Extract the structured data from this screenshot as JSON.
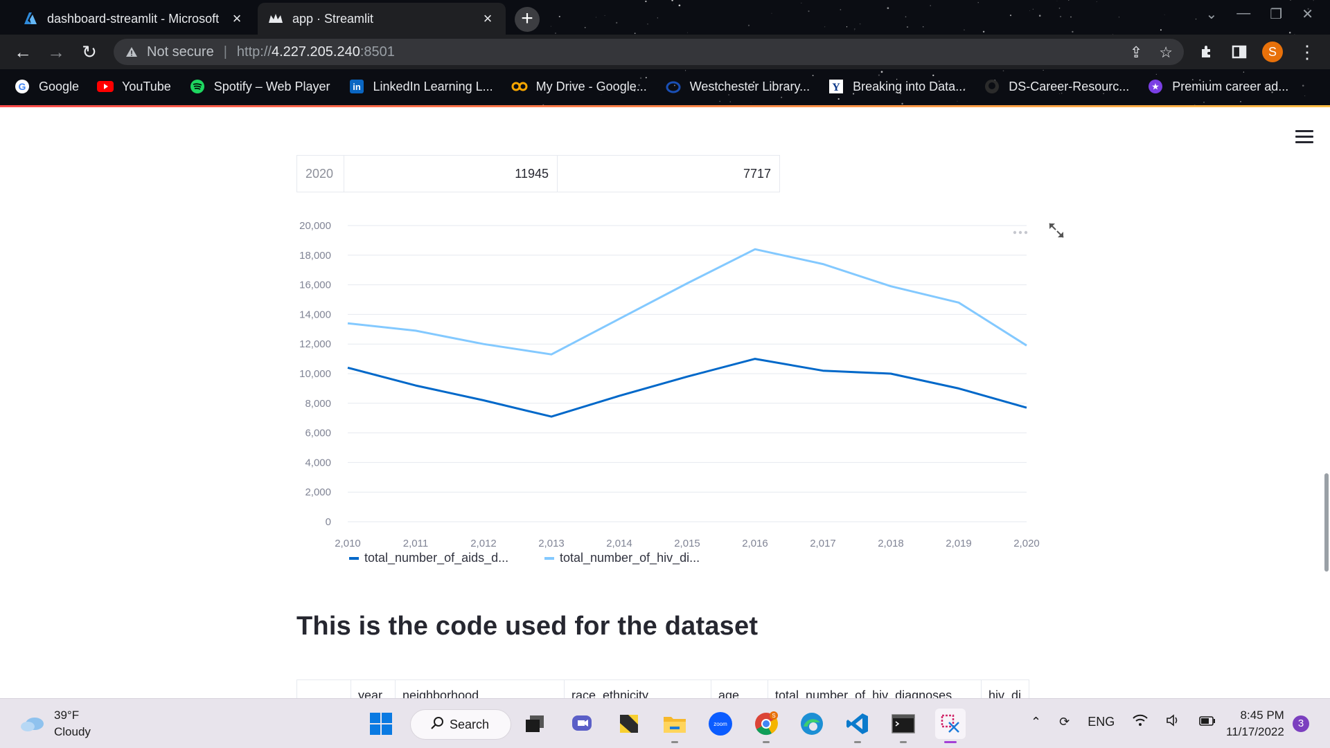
{
  "browser": {
    "tabs": [
      {
        "title": "dashboard-streamlit - Microsoft",
        "active": false
      },
      {
        "title": "app · Streamlit",
        "active": true
      }
    ],
    "security_label": "Not secure",
    "url_scheme": "http://",
    "url_host": "4.227.205.240",
    "url_port": ":8501",
    "profile_initial": "S",
    "bookmarks": [
      {
        "label": "Google",
        "icon": "google-icon"
      },
      {
        "label": "YouTube",
        "icon": "youtube-icon"
      },
      {
        "label": "Spotify – Web Player",
        "icon": "spotify-icon"
      },
      {
        "label": "LinkedIn Learning L...",
        "icon": "linkedin-icon"
      },
      {
        "label": "My Drive - Google...",
        "icon": "drive-icon"
      },
      {
        "label": "Westchester Library...",
        "icon": "library-icon"
      },
      {
        "label": "Breaking into Data...",
        "icon": "y-icon"
      },
      {
        "label": "DS-Career-Resourc...",
        "icon": "github-icon"
      },
      {
        "label": "Premium career ad...",
        "icon": "star-badge-icon"
      }
    ]
  },
  "table_row": {
    "index": "2020",
    "col1": "11945",
    "col2": "7717"
  },
  "chart_data": {
    "type": "line",
    "x": [
      2010,
      2011,
      2012,
      2013,
      2014,
      2015,
      2016,
      2017,
      2018,
      2019,
      2020
    ],
    "x_tick_labels": [
      "2,010",
      "2,011",
      "2,012",
      "2,013",
      "2,014",
      "2,015",
      "2,016",
      "2,017",
      "2,018",
      "2,019",
      "2,020"
    ],
    "y_tick_labels": [
      "0",
      "2,000",
      "4,000",
      "6,000",
      "8,000",
      "10,000",
      "12,000",
      "14,000",
      "16,000",
      "18,000",
      "20,000"
    ],
    "ylim": [
      0,
      20000
    ],
    "grid": true,
    "legend_position": "bottom-left",
    "series": [
      {
        "name": "total_number_of_aids_d...",
        "color": "#0068c9",
        "values": [
          10400,
          9200,
          8200,
          7100,
          8500,
          9800,
          11000,
          10200,
          10000,
          9000,
          7700
        ]
      },
      {
        "name": "total_number_of_hiv_di...",
        "color": "#83c9ff",
        "values": [
          13400,
          12900,
          12000,
          11300,
          13700,
          16100,
          18400,
          17400,
          15900,
          14800,
          11900
        ]
      }
    ]
  },
  "section_heading": "This is the code used for the dataset",
  "code_table_headers": [
    "",
    "year",
    "neighborhood",
    "race_ethnicity",
    "age",
    "total_number_of_hiv_diagnoses",
    "hiv_di"
  ],
  "taskbar": {
    "weather_temp": "39°F",
    "weather_desc": "Cloudy",
    "search_label": "Search",
    "language": "ENG",
    "time": "8:45 PM",
    "date": "11/17/2022",
    "notification_count": "3"
  }
}
